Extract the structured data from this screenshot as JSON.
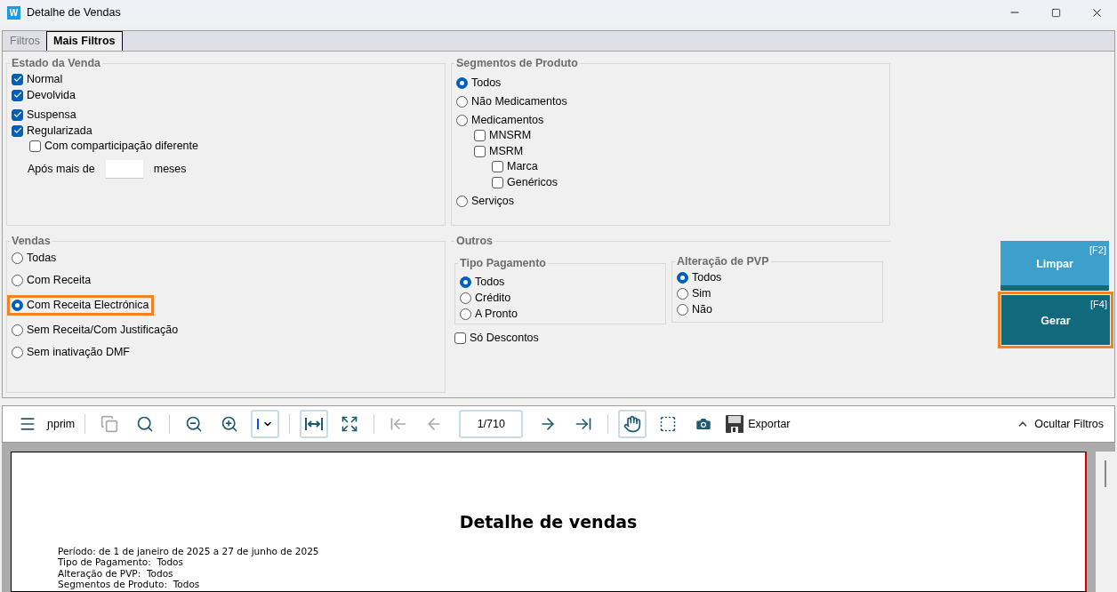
{
  "window": {
    "title": "Detalhe de Vendas",
    "logo": "W"
  },
  "tabs": [
    {
      "label": "Filtros",
      "selected": false
    },
    {
      "label": "Mais Filtros",
      "selected": true
    }
  ],
  "estado_da_venda": {
    "title": "Estado da Venda",
    "options": [
      {
        "kind": "checkbox",
        "label": "Normal",
        "checked": true
      },
      {
        "kind": "checkbox",
        "label": "Devolvida",
        "checked": true
      },
      {
        "kind": "checkbox",
        "label": "Suspensa",
        "checked": true
      },
      {
        "kind": "checkbox",
        "label": "Regularizada",
        "checked": true,
        "children": [
          {
            "kind": "checkbox",
            "label": "Com comparticipação diferente",
            "checked": false
          }
        ]
      }
    ],
    "months_field": {
      "label": "Após mais de",
      "unit": "meses"
    }
  },
  "segmentos_de_produto": {
    "title": "Segmentos de Produto",
    "options": [
      {
        "kind": "radio",
        "label": "Todos",
        "selected": true
      },
      {
        "kind": "radio",
        "label": "Não Medicamentos",
        "selected": false
      },
      {
        "kind": "radio",
        "label": "Medicamentos",
        "selected": false,
        "children": [
          {
            "kind": "checkbox",
            "label": "MNSRM",
            "checked": false
          },
          {
            "kind": "checkbox",
            "label": "MSRM",
            "checked": false,
            "children": [
              {
                "kind": "checkbox",
                "label": "Marca",
                "checked": false
              },
              {
                "kind": "checkbox",
                "label": "Genéricos",
                "checked": false
              }
            ]
          }
        ]
      },
      {
        "kind": "radio",
        "label": "Serviços",
        "selected": false
      }
    ]
  },
  "vendas": {
    "title": "Vendas",
    "options": [
      {
        "kind": "radio",
        "label": "Todas",
        "selected": false,
        "highlighted": false
      },
      {
        "kind": "radio",
        "label": "Com Receita",
        "selected": false,
        "highlighted": false
      },
      {
        "kind": "radio",
        "label": "Com Receita Electrónica",
        "selected": true,
        "highlighted": true
      },
      {
        "kind": "radio",
        "label": "Sem Receita/Com Justificação",
        "selected": false,
        "highlighted": false
      },
      {
        "kind": "radio",
        "label": "Sem inativação DMF",
        "selected": false,
        "highlighted": false
      }
    ]
  },
  "outros": {
    "title": "Outros",
    "tipo_pagamento": {
      "title": "Tipo Pagamento",
      "options": [
        {
          "kind": "radio",
          "label": "Todos",
          "selected": true
        },
        {
          "kind": "radio",
          "label": "Crédito",
          "selected": false
        },
        {
          "kind": "radio",
          "label": "A Pronto",
          "selected": false
        }
      ]
    },
    "alteracao_de_pvp": {
      "title": "Alteração de PVP",
      "options": [
        {
          "kind": "radio",
          "label": "Todos",
          "selected": true
        },
        {
          "kind": "radio",
          "label": "Sim",
          "selected": false
        },
        {
          "kind": "radio",
          "label": "Não",
          "selected": false
        }
      ]
    },
    "so_descontos": {
      "kind": "checkbox",
      "label": "Só Descontos",
      "checked": false
    }
  },
  "action_buttons": [
    {
      "kind": "clear",
      "label": "Limpar",
      "shortcut": "[F2]",
      "highlighted": false
    },
    {
      "kind": "generate",
      "label": "Gerar",
      "shortcut": "[F4]",
      "highlighted": true
    }
  ],
  "toolbar": [
    {
      "kind": "menu",
      "disabled": false,
      "selected": false
    },
    {
      "kind": "print",
      "label": "ɲprim"
    },
    {
      "kind": "separator"
    },
    {
      "kind": "copy",
      "disabled": true,
      "selected": false
    },
    {
      "kind": "search",
      "disabled": false,
      "selected": false
    },
    {
      "kind": "separator"
    },
    {
      "kind": "zoom_out",
      "disabled": false,
      "selected": false
    },
    {
      "kind": "zoom_in",
      "disabled": false,
      "selected": false
    },
    {
      "kind": "zoom_mode",
      "disabled": false
    },
    {
      "kind": "separator"
    },
    {
      "kind": "fit_width",
      "disabled": false,
      "selected": true
    },
    {
      "kind": "full_page",
      "disabled": false,
      "selected": false
    },
    {
      "kind": "separator"
    },
    {
      "kind": "first",
      "disabled": true,
      "selected": false
    },
    {
      "kind": "prev",
      "disabled": true,
      "selected": false
    },
    {
      "kind": "page",
      "value": "1/710"
    },
    {
      "kind": "next",
      "disabled": false,
      "selected": false
    },
    {
      "kind": "last",
      "disabled": false,
      "selected": false
    },
    {
      "kind": "separator"
    },
    {
      "kind": "pan",
      "disabled": false,
      "selected": true
    },
    {
      "kind": "select_area",
      "disabled": false,
      "selected": false
    },
    {
      "kind": "snapshot",
      "disabled": false,
      "selected": false
    },
    {
      "kind": "export",
      "label": "Exportar"
    },
    {
      "kind": "hide_filters",
      "label": "Ocultar Filtros"
    }
  ],
  "report": {
    "title": "Detalhe de vendas",
    "lines": [
      "Período: de 1 de janeiro de 2025 a 27 de junho de 2025",
      "Tipo de Pagamento:  Todos",
      "Alteração de PVP:  Todos",
      "Segmentos de Produto:  Todos"
    ]
  }
}
